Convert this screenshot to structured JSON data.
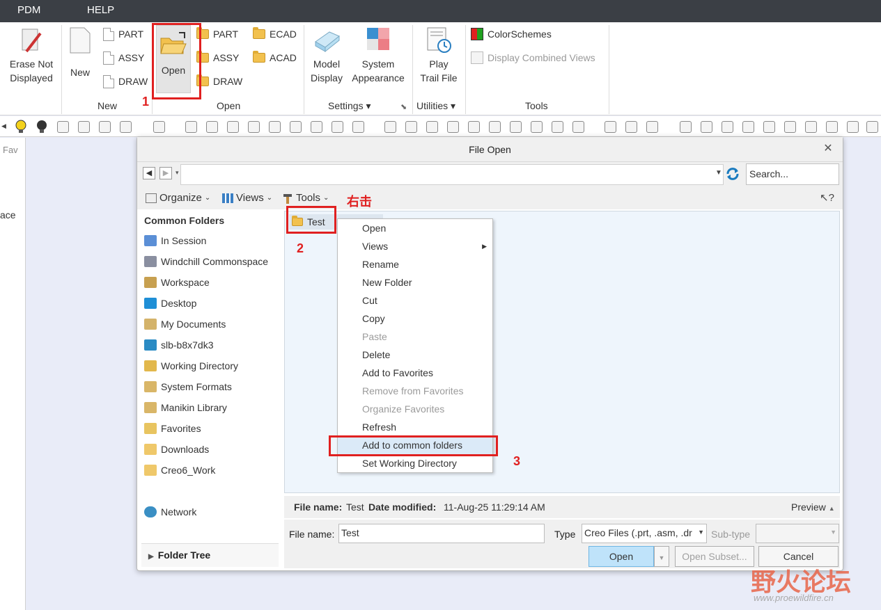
{
  "menubar": {
    "pdm": "PDM",
    "help": "HELP"
  },
  "ribbon": {
    "erase_label": "Erase Not\nDisplayed",
    "new_label": "New",
    "new_items": [
      "PART",
      "ASSY",
      "DRAW"
    ],
    "new_group": "New",
    "open_label": "Open",
    "open_items": [
      "PART",
      "ASSY",
      "DRAW"
    ],
    "open_items2": [
      "ECAD",
      "ACAD"
    ],
    "open_group": "Open",
    "model_display": "Model\nDisplay",
    "system_appearance": "System\nAppearance",
    "settings_group": "Settings",
    "play_trail": "Play\nTrail File",
    "utilities_group": "Utilities",
    "colorschemes": "ColorSchemes",
    "display_combined": "Display Combined Views",
    "tools_group": "Tools"
  },
  "left_strip": {
    "fav": "Fav",
    "ace": "ace"
  },
  "dialog": {
    "title": "File Open",
    "close": "✕",
    "search_placeholder": "Search...",
    "organize": "Organize",
    "views": "Views",
    "tools": "Tools",
    "help_cursor": "?",
    "common_folders": "Common Folders",
    "folders": [
      {
        "label": "In Session",
        "color": "#5b8fd6"
      },
      {
        "label": "Windchill Commonspace",
        "color": "#8a8fa0"
      },
      {
        "label": "Workspace",
        "color": "#c7a050"
      },
      {
        "label": "Desktop",
        "color": "#1f8fd6"
      },
      {
        "label": "My Documents",
        "color": "#d4b36a"
      },
      {
        "label": "slb-b8x7dk3",
        "color": "#2a8bc4"
      },
      {
        "label": "Working Directory",
        "color": "#e2b84c"
      },
      {
        "label": "System Formats",
        "color": "#d9b668"
      },
      {
        "label": "Manikin Library",
        "color": "#d9b668"
      },
      {
        "label": "Favorites",
        "color": "#e8c460"
      },
      {
        "label": "Downloads",
        "color": "#efc86a"
      },
      {
        "label": "Creo6_Work",
        "color": "#efc86a"
      }
    ],
    "network": "Network",
    "folder_tree": "Folder Tree",
    "file_item": "Test",
    "context_menu": [
      {
        "label": "Open",
        "disabled": false
      },
      {
        "label": "Views",
        "disabled": false,
        "submenu": true
      },
      {
        "label": "Rename",
        "disabled": false
      },
      {
        "label": "New Folder",
        "disabled": false
      },
      {
        "label": "Cut",
        "disabled": false
      },
      {
        "label": "Copy",
        "disabled": false
      },
      {
        "label": "Paste",
        "disabled": true
      },
      {
        "label": "Delete",
        "disabled": false
      },
      {
        "label": "Add to Favorites",
        "disabled": false
      },
      {
        "label": "Remove from Favorites",
        "disabled": true
      },
      {
        "label": "Organize Favorites",
        "disabled": true
      },
      {
        "label": "Refresh",
        "disabled": false
      },
      {
        "label": "Add to common folders",
        "disabled": false,
        "highlighted": true
      },
      {
        "label": "Set Working Directory",
        "disabled": false
      }
    ],
    "info": {
      "file_name_label": "File name:",
      "file_name_value": "Test",
      "date_label": "Date modified:",
      "date_value": "11-Aug-25 11:29:14 AM",
      "preview": "Preview"
    },
    "bottom": {
      "file_name_label": "File name:",
      "file_name_value": "Test",
      "type_label": "Type",
      "type_value": "Creo Files (.prt, .asm, .dr",
      "subtype_label": "Sub-type",
      "open_btn": "Open",
      "open_subset_btn": "Open Subset...",
      "cancel_btn": "Cancel"
    }
  },
  "annotations": {
    "step1": "1",
    "step2": "2",
    "step3": "3",
    "right_click": "右击"
  },
  "watermark": {
    "text": "野火论坛",
    "url": "www.proewildfire.cn"
  }
}
